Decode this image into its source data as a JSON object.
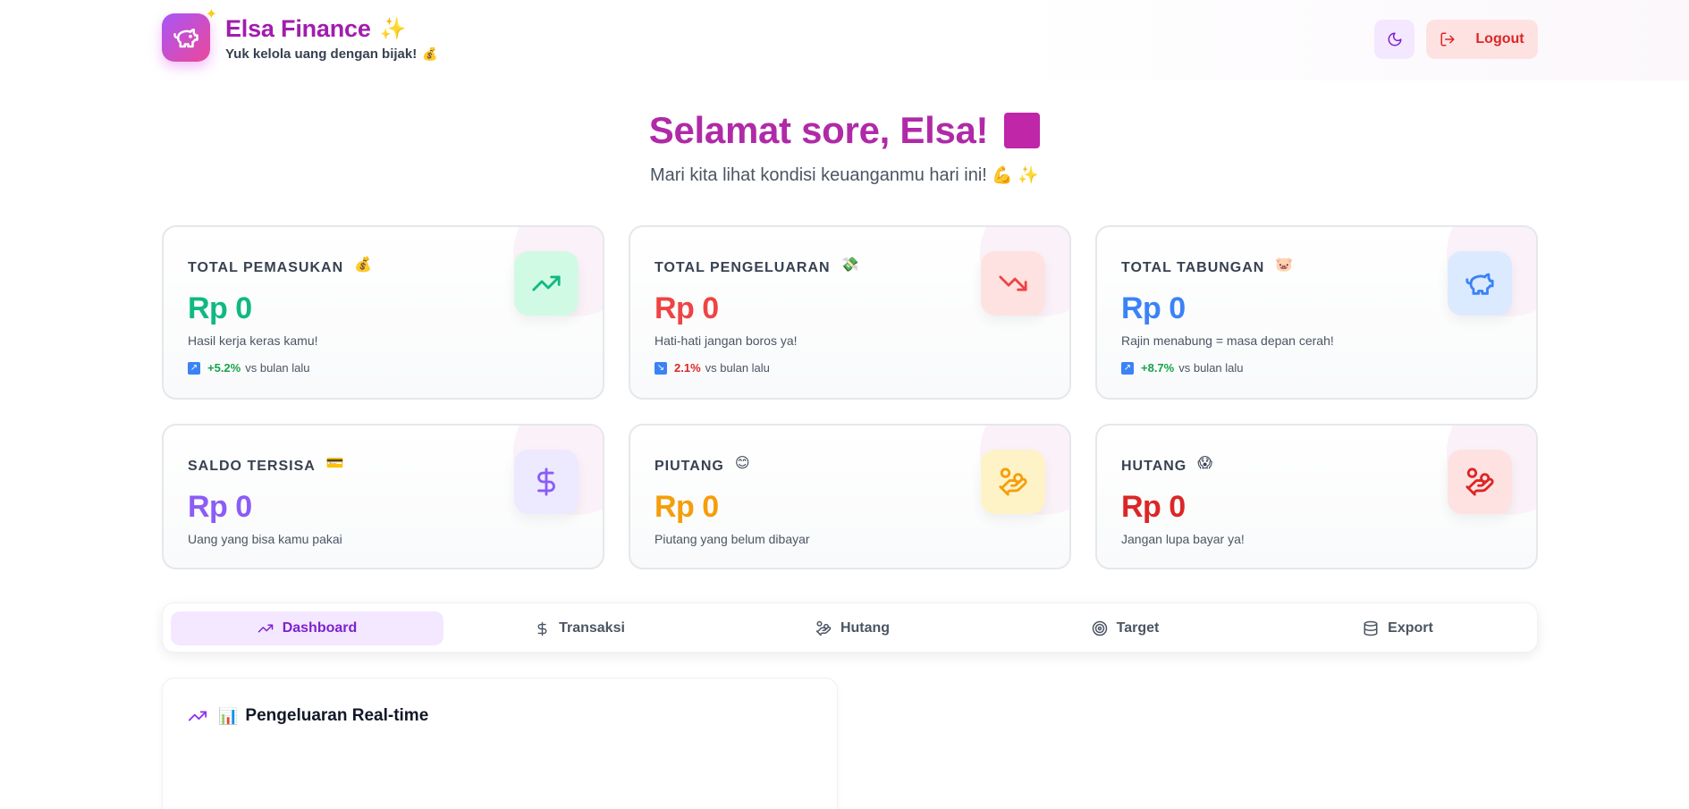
{
  "header": {
    "title": "Elsa Finance",
    "title_emoji": "✨",
    "subtitle": "Yuk kelola uang dengan bijak!",
    "subtitle_emoji": "💰",
    "logout_label": "Logout"
  },
  "greeting": {
    "title": "Selamat sore, Elsa!",
    "subtitle": "Mari kita lihat kondisi keuanganmu hari ini!",
    "subtitle_emoji": "💪 ✨"
  },
  "cards": [
    {
      "label": "TOTAL PEMASUKAN",
      "emoji": "💰",
      "value": "Rp 0",
      "desc": "Hasil kerja keras kamu!",
      "trend_value": "+5.2%",
      "trend_text": "vs bulan lalu",
      "color": "#10b981",
      "icon": "trending-up-icon"
    },
    {
      "label": "TOTAL PENGELUARAN",
      "emoji": "💸",
      "value": "Rp 0",
      "desc": "Hati-hati jangan boros ya!",
      "trend_value": "2.1%",
      "trend_text": "vs bulan lalu",
      "color": "#ef4444",
      "icon": "trending-down-icon"
    },
    {
      "label": "TOTAL TABUNGAN",
      "emoji": "🐷",
      "value": "Rp 0",
      "desc": "Rajin menabung = masa depan cerah!",
      "trend_value": "+8.7%",
      "trend_text": "vs bulan lalu",
      "color": "#3b82f6",
      "icon": "piggy-bank-icon"
    },
    {
      "label": "SALDO TERSISA",
      "emoji": "💳",
      "value": "Rp 0",
      "desc": "Uang yang bisa kamu pakai",
      "color": "#8b5cf6",
      "icon": "dollar-icon"
    },
    {
      "label": "PIUTANG",
      "emoji": "😊",
      "value": "Rp 0",
      "desc": "Piutang yang belum dibayar",
      "color": "#f59e0b",
      "icon": "hand-coins-icon"
    },
    {
      "label": "HUTANG",
      "emoji": "😱",
      "value": "Rp 0",
      "desc": "Jangan lupa bayar ya!",
      "color": "#dc2626",
      "icon": "hand-coins-icon"
    }
  ],
  "tabs": [
    {
      "label": "Dashboard",
      "icon": "trending-up-icon",
      "active": true
    },
    {
      "label": "Transaksi",
      "icon": "dollar-icon"
    },
    {
      "label": "Hutang",
      "icon": "hand-coins-icon"
    },
    {
      "label": "Target",
      "icon": "target-icon"
    },
    {
      "label": "Export",
      "icon": "database-icon"
    }
  ],
  "panel": {
    "emoji": "📊",
    "title": "Pengeluaran Real-time"
  }
}
